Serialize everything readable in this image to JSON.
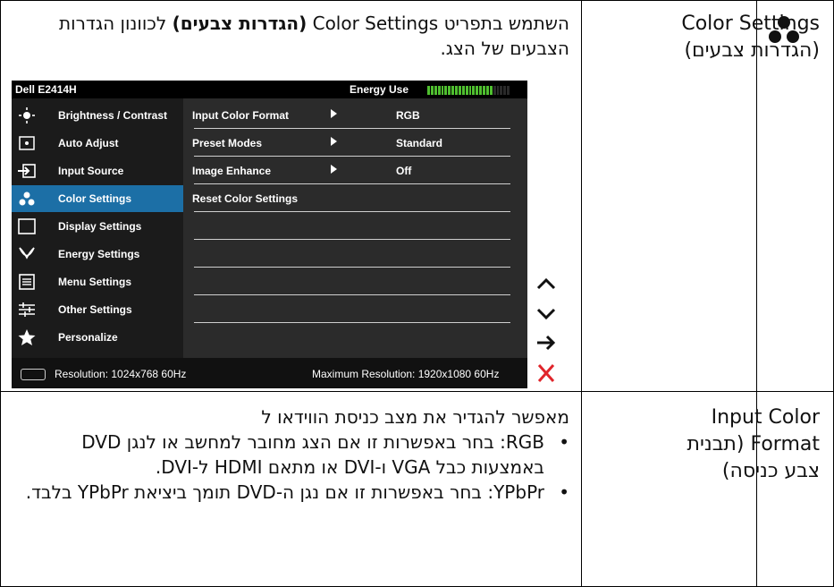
{
  "table": {
    "row1": {
      "term": "Color Settings (הגדרות צבעים)",
      "desc_before": "השתמש בתפריט Color Settings ",
      "desc_bold": "(הגדרות צבעים)",
      "desc_after": " לכוונון הגדרות הצבעים של הצג."
    },
    "row2": {
      "term": "Input Color Format (תבנית צבע כניסה)",
      "intro": "מאפשר להגדיר את מצב כניסת הווידאו ל",
      "bullets": [
        "RGB: בחר באפשרות זו אם הצג מחובר למחשב או לנגן DVD באמצעות כבל VGA ו-DVI או מתאם HDMI ל-DVI.",
        "YPbPr: בחר באפשרות זו אם נגן ה-DVD תומך ביציאת YPbPr בלבד."
      ]
    }
  },
  "osd": {
    "model": "Dell E2414H",
    "energy_label": "Energy Use",
    "energy_level": 0.8,
    "menu": [
      {
        "label": "Brightness / Contrast",
        "icon": "brightness-icon"
      },
      {
        "label": "Auto Adjust",
        "icon": "auto-adjust-icon"
      },
      {
        "label": "Input Source",
        "icon": "input-source-icon"
      },
      {
        "label": "Color Settings",
        "icon": "color-settings-icon",
        "active": true
      },
      {
        "label": "Display Settings",
        "icon": "display-settings-icon"
      },
      {
        "label": "Energy Settings",
        "icon": "energy-settings-icon"
      },
      {
        "label": "Menu Settings",
        "icon": "menu-settings-icon"
      },
      {
        "label": "Other Settings",
        "icon": "other-settings-icon"
      },
      {
        "label": "Personalize",
        "icon": "star-icon"
      }
    ],
    "options": [
      {
        "name": "Input Color Format",
        "value": "RGB"
      },
      {
        "name": "Preset Modes",
        "value": "Standard"
      },
      {
        "name": "Image Enhance",
        "value": "Off"
      },
      {
        "name": "Reset Color Settings",
        "value": ""
      }
    ],
    "footer": {
      "resolution": "Resolution:  1024x768 60Hz",
      "max_resolution": "Maximum Resolution:  1920x1080 60Hz"
    },
    "nav": [
      "up-arrow-icon",
      "down-arrow-icon",
      "right-arrow-icon",
      "exit-x-icon"
    ],
    "colors": {
      "active": "#1c6fa6",
      "energy": "#4fbf2f",
      "exit": "#e0252b"
    }
  }
}
